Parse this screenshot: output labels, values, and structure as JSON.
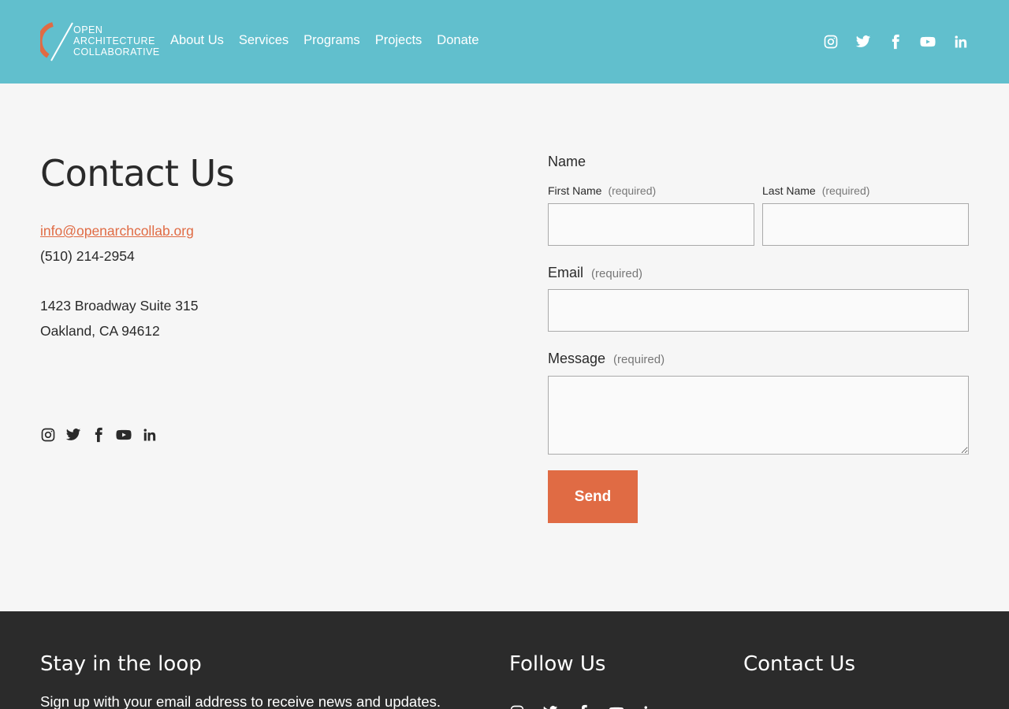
{
  "brand": {
    "logo_line1": "OPEN",
    "logo_line2": "ARCHITECTURE",
    "logo_line3": "COLLABORATIVE",
    "accent": "#e06b44",
    "header_bg": "#61bfcd",
    "footer_bg": "#2b2b2b"
  },
  "nav": {
    "items": [
      "About Us",
      "Services",
      "Programs",
      "Projects",
      "Donate"
    ]
  },
  "social_icons": [
    "instagram-icon",
    "twitter-icon",
    "facebook-icon",
    "youtube-icon",
    "linkedin-icon"
  ],
  "contact": {
    "title": "Contact Us",
    "email": "info@openarchcollab.org",
    "phone": "(510) 214-2954",
    "address_line1": "1423 Broadway Suite 315",
    "address_line2": "Oakland, CA 94612"
  },
  "form": {
    "name_label": "Name",
    "first_name_label": "First Name",
    "last_name_label": "Last Name",
    "email_label": "Email",
    "message_label": "Message",
    "required_text": "(required)",
    "first_name_value": "",
    "last_name_value": "",
    "email_value": "",
    "message_value": "",
    "send_label": "Send"
  },
  "footer": {
    "newsletter_title": "Stay in the loop",
    "newsletter_text": "Sign up with your email address to receive news and updates.",
    "follow_title": "Follow Us",
    "contact_title": "Contact Us"
  }
}
